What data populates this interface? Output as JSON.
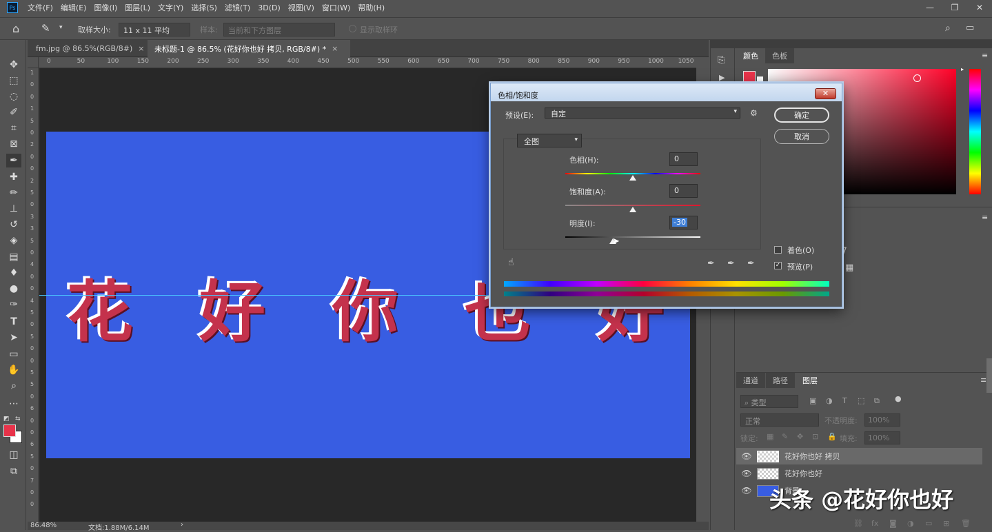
{
  "menubar": {
    "logo": "Ps",
    "items": [
      "文件(F)",
      "编辑(E)",
      "图像(I)",
      "图层(L)",
      "文字(Y)",
      "选择(S)",
      "滤镜(T)",
      "3D(D)",
      "视图(V)",
      "窗口(W)",
      "帮助(H)"
    ]
  },
  "options": {
    "sample_size_label": "取样大小:",
    "sample_size_value": "11 x 11 平均",
    "sample_label": "样本:",
    "sample_value": "当前和下方图层",
    "show_ring_label": "显示取样环"
  },
  "tabs": [
    {
      "label": "fm.jpg @ 86.5%(RGB/8#)",
      "close": "×"
    },
    {
      "label": "未标题-1 @ 86.5% (花好你也好 拷贝, RGB/8#) *",
      "close": "×"
    }
  ],
  "ruler_h": [
    "0",
    "50",
    "100",
    "150",
    "200",
    "250",
    "300",
    "350",
    "400",
    "450",
    "500",
    "550",
    "600",
    "650",
    "700",
    "750",
    "800",
    "850",
    "900",
    "950",
    "1000",
    "1050"
  ],
  "ruler_v": [
    "1",
    "0",
    "0",
    "1",
    "5",
    "0",
    "2",
    "0",
    "0",
    "2",
    "5",
    "0",
    "3",
    "3",
    "5",
    "0",
    "4",
    "0",
    "0",
    "4",
    "5",
    "0",
    "5",
    "0",
    "0",
    "5",
    "5",
    "0",
    "6",
    "0",
    "0",
    "6",
    "5",
    "0",
    "7",
    "0",
    "0"
  ],
  "canvas": {
    "chars": [
      "花",
      "好",
      "你",
      "也",
      "好"
    ],
    "bg": "#385de2",
    "text_color": "#c4324c"
  },
  "status": {
    "zoom": "86.48%",
    "doc": "文档:1.88M/6.14M",
    "arrow": "›"
  },
  "color_panel": {
    "tabs": [
      "颜色",
      "色板"
    ],
    "fg": "#e8334a"
  },
  "layers_panel": {
    "tabs": [
      "通道",
      "路径",
      "图层"
    ],
    "filter": "类型",
    "blend": "正常",
    "opacity_label": "不透明度:",
    "opacity": "100%",
    "lock_label": "锁定:",
    "fill_label": "填充:",
    "fill": "100%",
    "layers": [
      {
        "name": "花好你也好 拷贝"
      },
      {
        "name": "花好你也好"
      },
      {
        "name": "背景"
      }
    ]
  },
  "dialog": {
    "title": "色相/饱和度",
    "close": "✕",
    "preset_label": "预设(E):",
    "preset_value": "自定",
    "ok": "确定",
    "cancel": "取消",
    "range": "全图",
    "hue_label": "色相(H):",
    "hue": "0",
    "sat_label": "饱和度(A):",
    "sat": "0",
    "light_label": "明度(I):",
    "light": "-30",
    "colorize_label": "着色(O)",
    "preview_label": "预览(P)",
    "preview_checked": "✓"
  },
  "right_panel_glyphs": {
    "a": "7",
    "b": "▦"
  },
  "watermark": "头条 @花好你也好"
}
